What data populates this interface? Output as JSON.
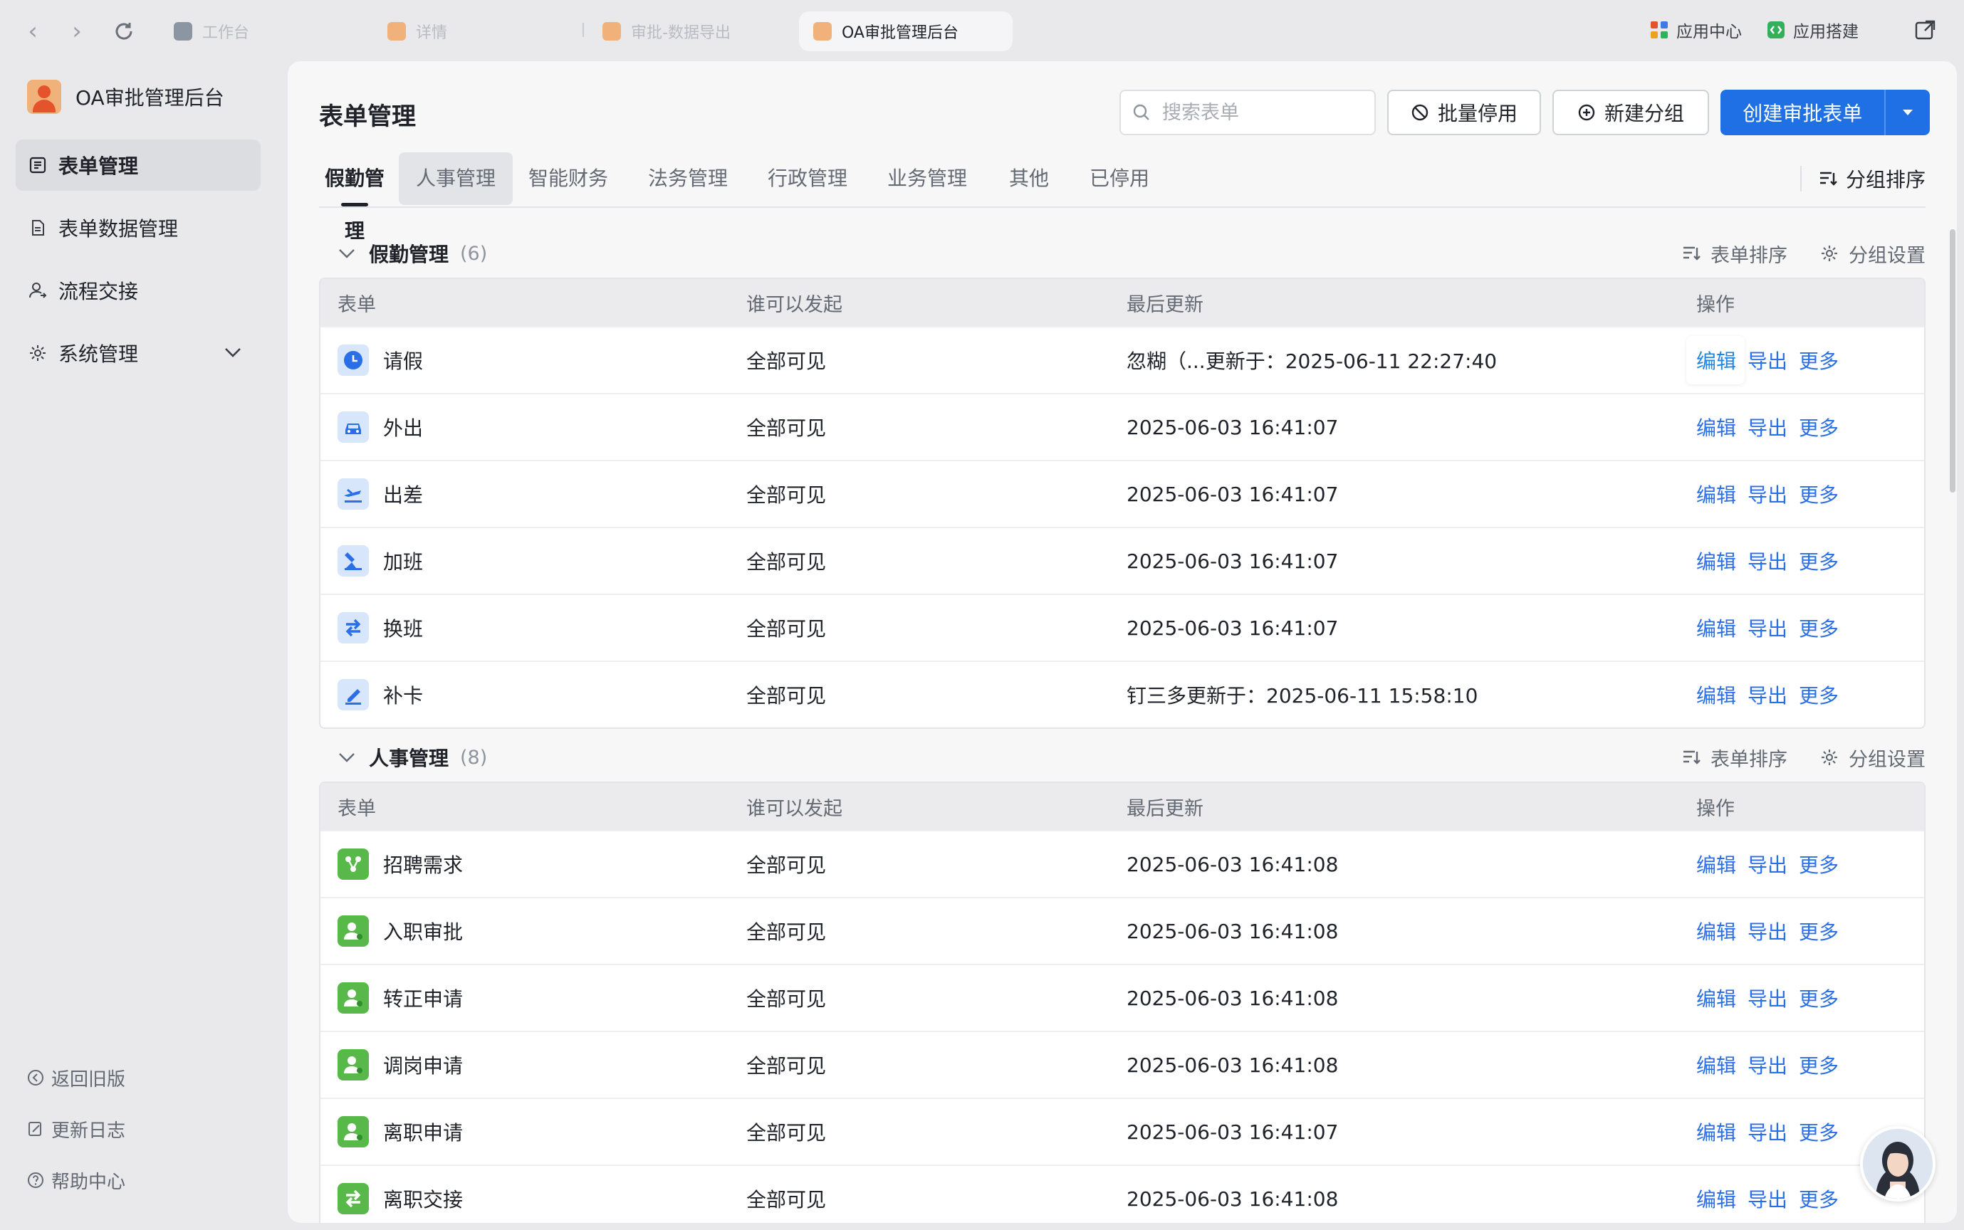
{
  "browser": {
    "tabs": [
      {
        "label": "工作台"
      },
      {
        "label": "详情"
      },
      {
        "label": "审批-数据导出"
      },
      {
        "label": "OA审批管理后台"
      }
    ],
    "right_items": [
      {
        "label": "应用中心"
      },
      {
        "label": "应用搭建"
      }
    ]
  },
  "sidebar": {
    "app_title": "OA审批管理后台",
    "items": [
      {
        "label": "表单管理"
      },
      {
        "label": "表单数据管理"
      },
      {
        "label": "流程交接"
      },
      {
        "label": "系统管理"
      }
    ],
    "footer": [
      {
        "label": "返回旧版"
      },
      {
        "label": "更新日志"
      },
      {
        "label": "帮助中心"
      }
    ]
  },
  "header": {
    "title": "表单管理",
    "search_placeholder": "搜索表单",
    "batch_disable": "批量停用",
    "new_group": "新建分组",
    "create_form": "创建审批表单"
  },
  "tabs": {
    "items": [
      "假勤管理",
      "人事管理",
      "智能财务",
      "法务管理",
      "行政管理",
      "业务管理",
      "其他",
      "已停用"
    ],
    "sort_label": "分组排序"
  },
  "columns": {
    "form": "表单",
    "who": "谁可以发起",
    "updated": "最后更新",
    "ops": "操作"
  },
  "actions": {
    "edit": "编辑",
    "export": "导出",
    "more": "更多"
  },
  "group_actions": {
    "sort": "表单排序",
    "settings": "分组设置"
  },
  "groups": [
    {
      "name": "假勤管理",
      "count": "(6)",
      "rows": [
        {
          "name": "请假",
          "who": "全部可见",
          "updated": "忽糊（...更新于：2025-06-11 22:27:40"
        },
        {
          "name": "外出",
          "who": "全部可见",
          "updated": "2025-06-03 16:41:07"
        },
        {
          "name": "出差",
          "who": "全部可见",
          "updated": "2025-06-03 16:41:07"
        },
        {
          "name": "加班",
          "who": "全部可见",
          "updated": "2025-06-03 16:41:07"
        },
        {
          "name": "换班",
          "who": "全部可见",
          "updated": "2025-06-03 16:41:07"
        },
        {
          "name": "补卡",
          "who": "全部可见",
          "updated": "钉三多更新于：2025-06-11 15:58:10"
        }
      ]
    },
    {
      "name": "人事管理",
      "count": "(8)",
      "rows": [
        {
          "name": "招聘需求",
          "who": "全部可见",
          "updated": "2025-06-03 16:41:08"
        },
        {
          "name": "入职审批",
          "who": "全部可见",
          "updated": "2025-06-03 16:41:08"
        },
        {
          "name": "转正申请",
          "who": "全部可见",
          "updated": "2025-06-03 16:41:08"
        },
        {
          "name": "调岗申请",
          "who": "全部可见",
          "updated": "2025-06-03 16:41:08"
        },
        {
          "name": "离职申请",
          "who": "全部可见",
          "updated": "2025-06-03 16:41:07"
        },
        {
          "name": "离职交接",
          "who": "全部可见",
          "updated": "2025-06-03 16:41:08"
        }
      ]
    }
  ],
  "colors": {
    "primary": "#1f6fe5",
    "link": "#2a6ee8",
    "green_icon": "#58b84a",
    "blue_icon_bg": "#d7e6fb"
  }
}
